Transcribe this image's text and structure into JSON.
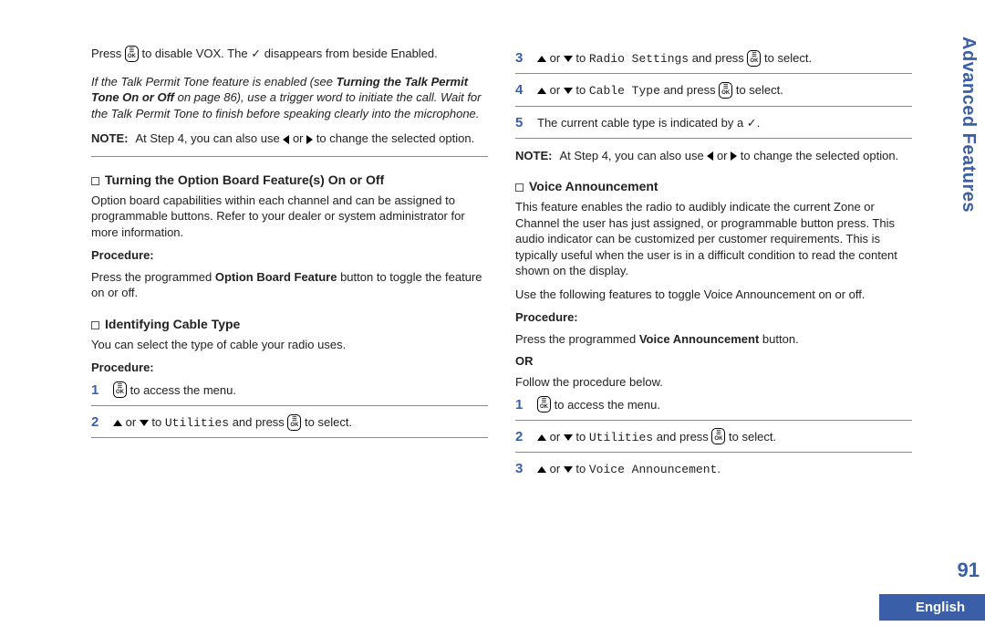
{
  "sideTab": "Advanced Features",
  "pageNumber": "91",
  "language": "English",
  "col1": {
    "p1a": "Press ",
    "p1b": " to disable VOX. The ",
    "p1check": "✓",
    "p1c": " disappears from beside Enabled.",
    "italic1": "If the Talk Permit Tone feature is enabled (see ",
    "italicBold": "Turning the Talk Permit Tone On or Off",
    "italic2": " on page 86), use a trigger word to initiate the call. Wait for the Talk Permit Tone to finish before speaking clearly into the microphone.",
    "noteLabel": "NOTE:",
    "noteText1": "At Step 4, you can also use ",
    "noteText2": " or ",
    "noteText3": " to change the selected option.",
    "h1": "Turning the Option Board Feature(s) On or Off",
    "p2": "Option board capabilities within each channel and can be assigned to programmable buttons. Refer to your dealer or system administrator for more information.",
    "proc": "Procedure:",
    "p3a": "Press the programmed ",
    "p3b": "Option Board Feature",
    "p3c": " button to toggle the feature on or off.",
    "h2": "Identifying Cable Type",
    "p4": "You can select the type of cable your radio uses.",
    "step1num": "1",
    "step1": " to access the menu.",
    "step2num": "2",
    "step2a": " or ",
    "step2b": " to ",
    "step2mono": "Utilities",
    "step2c": " and press ",
    "step2d": " to select."
  },
  "col2": {
    "step3num": "3",
    "step3a": " or ",
    "step3b": " to ",
    "step3mono": "Radio Settings",
    "step3c": " and press ",
    "step3d": " to select.",
    "step4num": "4",
    "step4a": " or ",
    "step4b": " to ",
    "step4mono": "Cable Type",
    "step4c": " and press ",
    "step4d": " to select.",
    "step5num": "5",
    "step5a": "The current cable type is indicated by a ",
    "step5check": "✓",
    "step5b": ".",
    "noteLabel": "NOTE:",
    "noteText1": "At Step 4, you can also use ",
    "noteText2": " or ",
    "noteText3": " to change the selected option.",
    "h1": "Voice Announcement",
    "p1": "This feature enables the radio to audibly indicate the current Zone or Channel the user has just assigned, or programmable button press. This audio indicator can be customized per customer requirements. This is typically useful when the user is in a difficult condition to read the content shown on the display.",
    "p2": "Use the following features to toggle Voice Announcement on or off.",
    "proc": "Procedure:",
    "p3a": "Press the programmed ",
    "p3b": "Voice Announcement",
    "p3c": " button.",
    "or": "OR",
    "p4": "Follow the procedure below.",
    "vstep1num": "1",
    "vstep1": " to access the menu.",
    "vstep2num": "2",
    "vstep2a": " or ",
    "vstep2b": " to ",
    "vstep2mono": "Utilities",
    "vstep2c": " and press ",
    "vstep2d": " to select.",
    "vstep3num": "3",
    "vstep3a": " or ",
    "vstep3b": " to ",
    "vstep3mono": "Voice Announcement",
    "vstep3c": "."
  }
}
